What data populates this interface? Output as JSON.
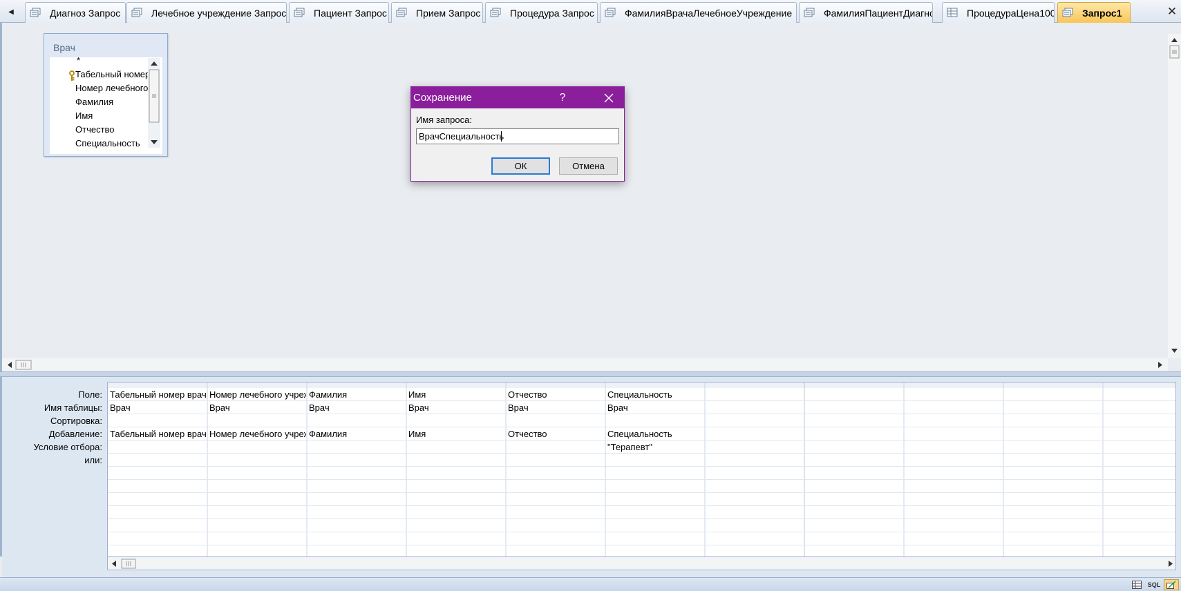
{
  "tabs": [
    {
      "label": "Диагноз Запрос",
      "icon": "query-icon",
      "active": false
    },
    {
      "label": "Лечебное учреждение Запрос",
      "icon": "query-icon",
      "active": false
    },
    {
      "label": "Пациент Запрос",
      "icon": "query-icon",
      "active": false
    },
    {
      "label": "Прием Запрос",
      "icon": "query-icon",
      "active": false
    },
    {
      "label": "Процедура Запрос",
      "icon": "query-icon",
      "active": false
    },
    {
      "label": "ФамилияВрачаЛечебноеУчреждение",
      "icon": "query-icon",
      "active": false
    },
    {
      "label": "ФамилияПациентДиагноз",
      "icon": "query-icon",
      "active": false
    },
    {
      "label": "ПроцедураЦена100",
      "icon": "table-icon",
      "active": false
    },
    {
      "label": "Запрос1",
      "icon": "query-icon",
      "active": true
    }
  ],
  "table_box": {
    "title": "Врач",
    "fields": [
      "*",
      "Табельный номер",
      "Номер лечебного",
      "Фамилия",
      "Имя",
      "Отчество",
      "Специальность"
    ],
    "primary_key_field_index": 1
  },
  "dialog": {
    "title": "Сохранение",
    "help_symbol": "?",
    "label": "Имя запроса:",
    "input_value": "ВрачСпециальность",
    "ok_label": "ОК",
    "cancel_label": "Отмена",
    "accent_color": "#8a1e9b"
  },
  "grid": {
    "row_labels": [
      "Поле:",
      "Имя таблицы:",
      "Сортировка:",
      "Добавление:",
      "Условие отбора:",
      "или:"
    ],
    "columns": [
      {
        "field": "Табельный номер врача",
        "table": "Врач",
        "sort": "",
        "show": "Табельный номер врача",
        "criteria": "",
        "or": ""
      },
      {
        "field": "Номер лечебного учреждения",
        "table": "Врач",
        "sort": "",
        "show": "Номер лечебного учреждения",
        "criteria": "",
        "or": ""
      },
      {
        "field": "Фамилия",
        "table": "Врач",
        "sort": "",
        "show": "Фамилия",
        "criteria": "",
        "or": ""
      },
      {
        "field": "Имя",
        "table": "Врач",
        "sort": "",
        "show": "Имя",
        "criteria": "",
        "or": ""
      },
      {
        "field": "Отчество",
        "table": "Врач",
        "sort": "",
        "show": "Отчество",
        "criteria": "",
        "or": ""
      },
      {
        "field": "Специальность",
        "table": "Врач",
        "sort": "",
        "show": "Специальность",
        "criteria": "\"Терапевт\"",
        "or": ""
      },
      {
        "field": "",
        "table": "",
        "sort": "",
        "show": "",
        "criteria": "",
        "or": ""
      },
      {
        "field": "",
        "table": "",
        "sort": "",
        "show": "",
        "criteria": "",
        "or": ""
      },
      {
        "field": "",
        "table": "",
        "sort": "",
        "show": "",
        "criteria": "",
        "or": ""
      },
      {
        "field": "",
        "table": "",
        "sort": "",
        "show": "",
        "criteria": "",
        "or": ""
      },
      {
        "field": "",
        "table": "",
        "sort": "",
        "show": "",
        "criteria": "",
        "or": ""
      },
      {
        "field": "",
        "table": "",
        "sort": "",
        "show": "",
        "criteria": "",
        "or": ""
      }
    ]
  },
  "status_bar": {
    "view_icons": [
      "datasheet-view-icon",
      "sql-view-icon",
      "design-view-icon"
    ],
    "sql_label": "SQL"
  },
  "colors": {
    "accent_tab": "#f8c65a",
    "dialog_titlebar": "#8a1e9b",
    "workspace": "#e9ecf0"
  }
}
